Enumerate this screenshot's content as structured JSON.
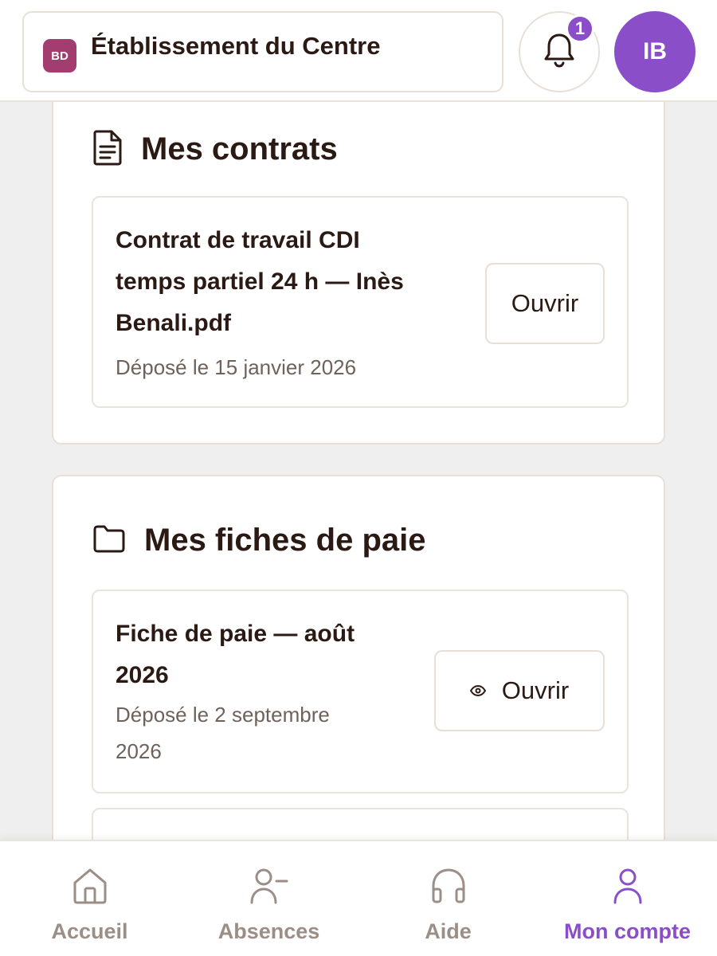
{
  "header": {
    "org_badge": "BD",
    "org_name": "Établissement du Centre",
    "notification_count": "1",
    "avatar_initials": "IB",
    "colors": {
      "accent": "#8a4fc8",
      "org_badge": "#a43d6f"
    }
  },
  "contracts": {
    "title": "Mes contrats",
    "icon": "document-icon",
    "items": [
      {
        "title_lines": [
          "Contrat de travail CDI",
          "temps partiel 24 h — Inès",
          "Benali.pdf"
        ],
        "date": "Déposé le 15 janvier 2026",
        "action": "Ouvrir"
      }
    ]
  },
  "payslips": {
    "title": "Mes fiches de paie",
    "icon": "folder-icon",
    "items": [
      {
        "title_lines": [
          "Fiche de paie — août",
          "2026"
        ],
        "date_lines": [
          "Déposé le 2 septembre",
          "2026"
        ],
        "action": "Ouvrir",
        "action_icon": "eye-icon"
      }
    ]
  },
  "nav": {
    "items": [
      {
        "label": "Accueil",
        "icon": "home-icon"
      },
      {
        "label": "Absences",
        "icon": "user-minus-icon"
      },
      {
        "label": "Aide",
        "icon": "headphones-icon"
      },
      {
        "label": "Mon compte",
        "icon": "user-icon",
        "active": true
      }
    ]
  }
}
